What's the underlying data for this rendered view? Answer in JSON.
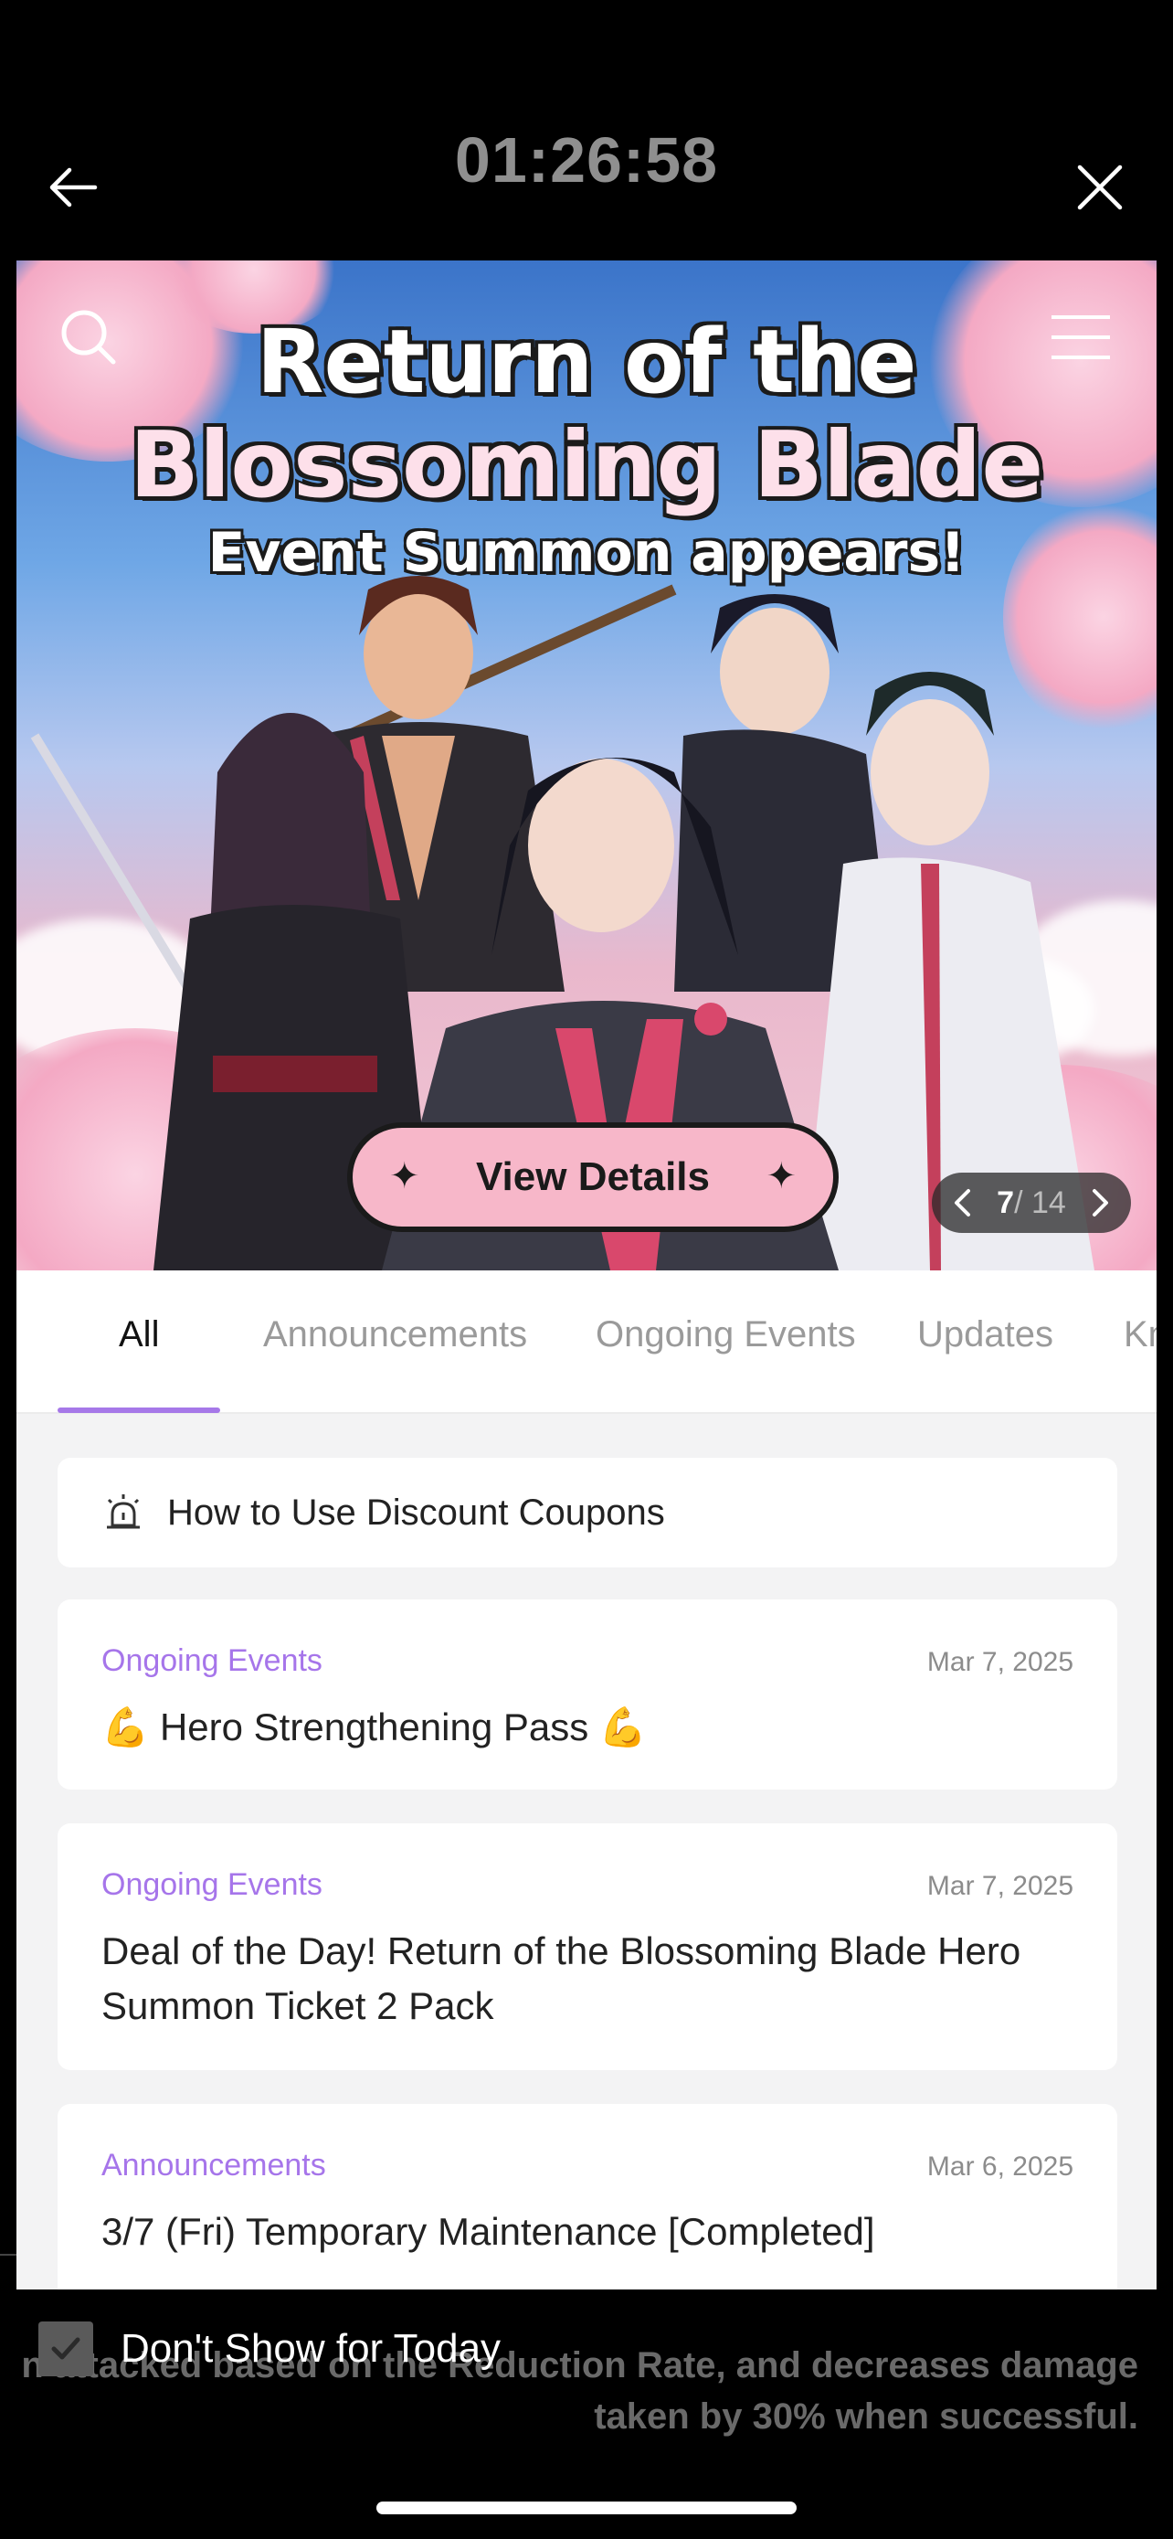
{
  "header": {
    "timer": "01:26:58",
    "back_icon": "arrow-left-icon",
    "close_icon": "close-icon"
  },
  "banner": {
    "title_line1": "Return of the",
    "title_line2": "Blossoming Blade",
    "subtitle": "Event Summon appears!",
    "cta_label": "View Details",
    "page_current": "7",
    "page_total": "14",
    "search_icon": "search-icon",
    "menu_icon": "menu-icon"
  },
  "tabs": [
    {
      "label": "All",
      "active": true
    },
    {
      "label": "Announcements",
      "active": false
    },
    {
      "label": "Ongoing Events",
      "active": false
    },
    {
      "label": "Updates",
      "active": false
    },
    {
      "label": "Kn",
      "active": false
    }
  ],
  "notice": {
    "icon": "alarm-icon",
    "text": "How to Use Discount Coupons"
  },
  "posts": [
    {
      "category": "Ongoing Events",
      "date": "Mar 7, 2025",
      "title": "💪 Hero Strengthening Pass 💪"
    },
    {
      "category": "Ongoing Events",
      "date": "Mar 7, 2025",
      "title": "Deal of the Day! Return of the Blossoming Blade Hero Summon Ticket 2 Pack"
    },
    {
      "category": "Announcements",
      "date": "Mar 6, 2025",
      "title": "3/7 (Fri) Temporary Maintenance [Completed]"
    }
  ],
  "footer": {
    "dont_show_label": "Don't Show for Today",
    "background_text": "n attacked based on the Reduction Rate, and decreases damage taken by 30% when successful."
  },
  "colors": {
    "accent": "#a675ea",
    "background": "#000000",
    "cta": "#f7b7c9"
  }
}
